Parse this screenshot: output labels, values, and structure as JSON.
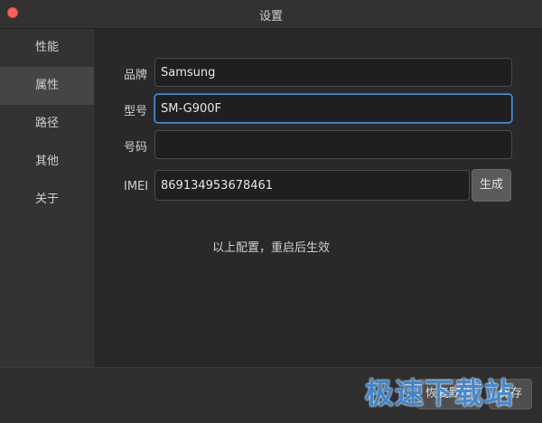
{
  "window": {
    "title": "设置"
  },
  "sidebar": {
    "items": [
      {
        "label": "性能",
        "active": false
      },
      {
        "label": "属性",
        "active": true
      },
      {
        "label": "路径",
        "active": false
      },
      {
        "label": "其他",
        "active": false
      },
      {
        "label": "关于",
        "active": false
      }
    ]
  },
  "form": {
    "brand": {
      "label": "品牌",
      "value": "Samsung"
    },
    "model": {
      "label": "型号",
      "value": "SM-G900F"
    },
    "number": {
      "label": "号码",
      "value": ""
    },
    "imei": {
      "label": "IMEI",
      "value": "869134953678461",
      "button": "生成"
    }
  },
  "hint": "以上配置，重启后生效",
  "footer": {
    "reset_label": "恢复默认",
    "save_label": "保存"
  },
  "watermark": "极速下载站",
  "colors": {
    "accent_focus": "#4a8fd9",
    "close": "#fc5f57",
    "watermark": "#3f8ede"
  }
}
